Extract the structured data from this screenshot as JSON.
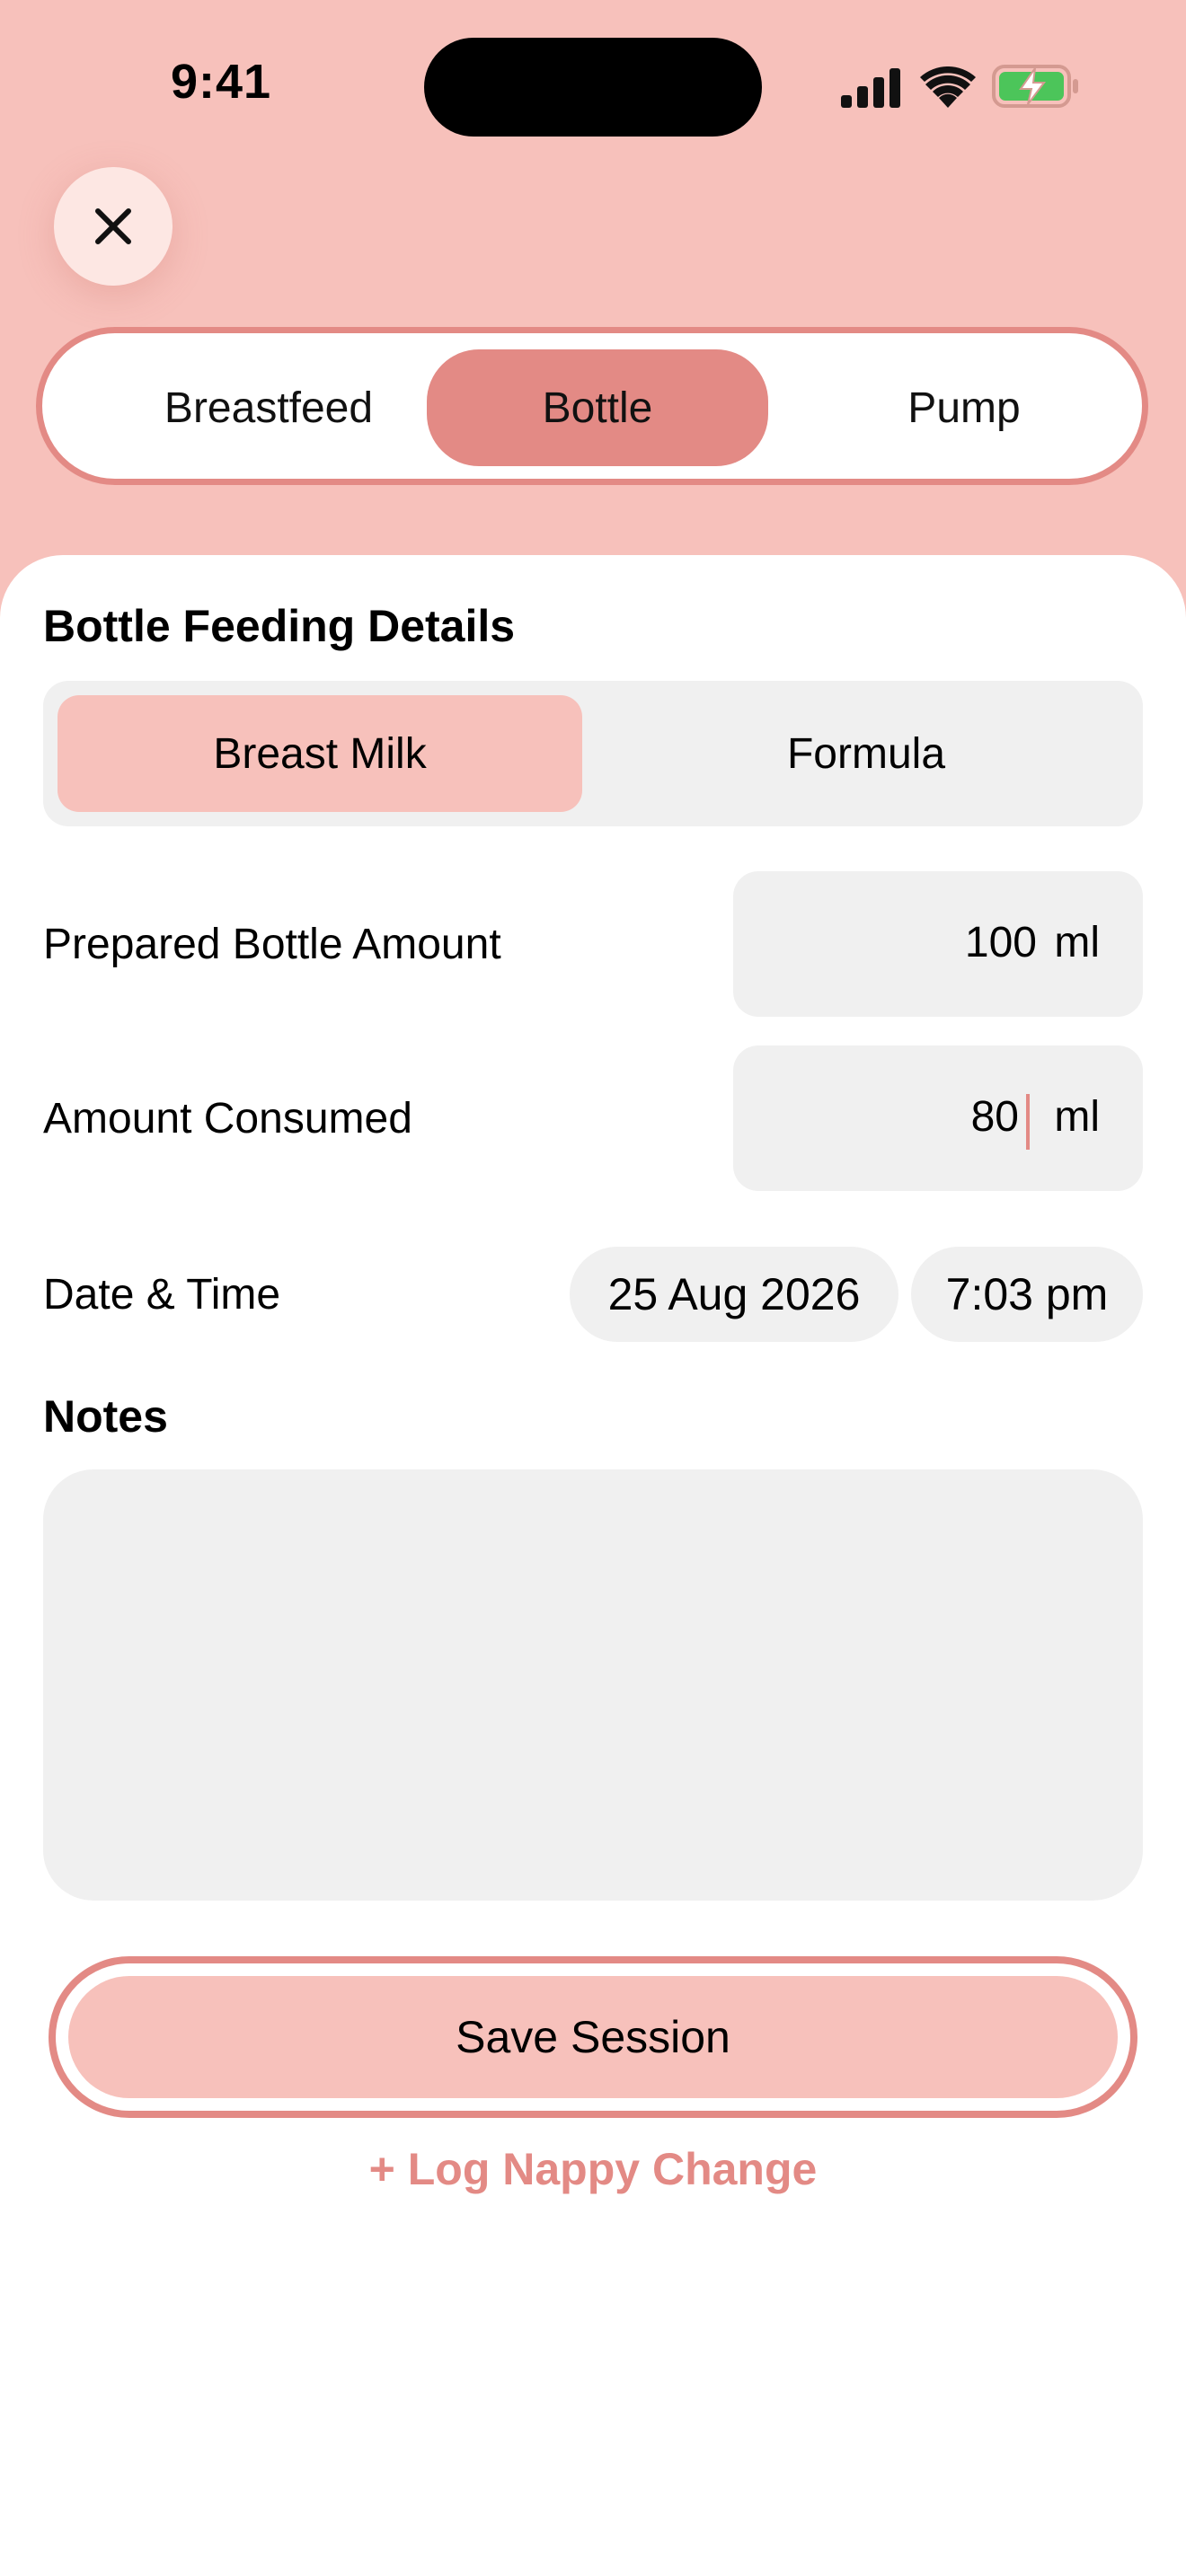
{
  "status_bar": {
    "time": "9:41"
  },
  "mode_tabs": [
    {
      "label": "Breastfeed",
      "active": false
    },
    {
      "label": "Bottle",
      "active": true
    },
    {
      "label": "Pump",
      "active": false
    }
  ],
  "details": {
    "title": "Bottle Feeding Details",
    "milk_types": [
      {
        "label": "Breast Milk",
        "active": true
      },
      {
        "label": "Formula",
        "active": false
      }
    ],
    "prepared_amount": {
      "label": "Prepared Bottle Amount",
      "value": "100",
      "unit": "ml"
    },
    "consumed_amount": {
      "label": "Amount Consumed",
      "value": "80",
      "unit": "ml"
    },
    "date_time": {
      "label": "Date & Time",
      "date": "25 Aug 2026",
      "time": "7:03 pm"
    }
  },
  "notes": {
    "title": "Notes",
    "value": ""
  },
  "actions": {
    "save_label": "Save Session",
    "nappy_label": "+ Log Nappy Change"
  },
  "colors": {
    "accent": "#e38a85",
    "accent_light": "#f7c1bb",
    "field_bg": "#f0f0f0"
  },
  "icons": {
    "close": "close-icon",
    "signal": "signal-icon",
    "wifi": "wifi-icon",
    "battery": "battery-charging-icon"
  }
}
